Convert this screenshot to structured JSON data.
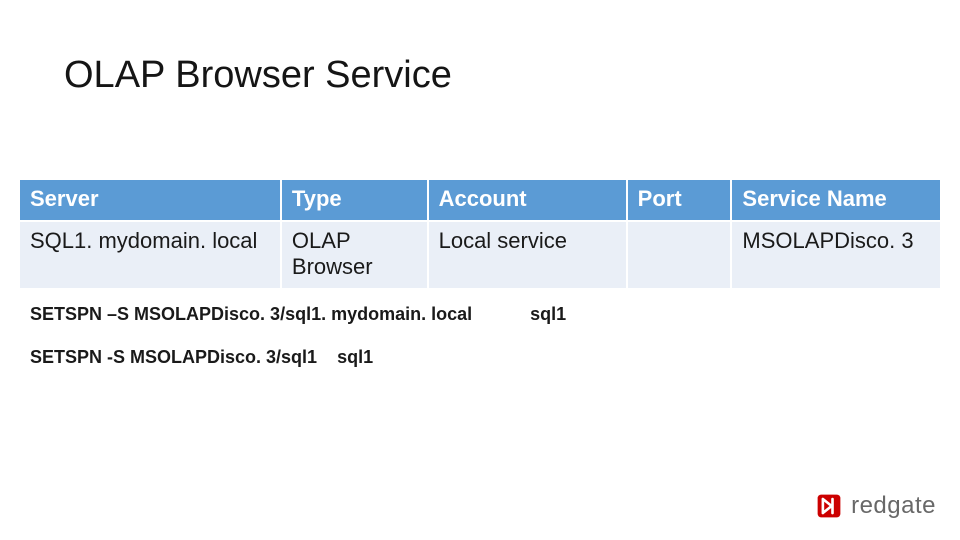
{
  "title": "OLAP Browser Service",
  "table": {
    "headers": [
      "Server",
      "Type",
      "Account",
      "Port",
      "Service Name"
    ],
    "row": {
      "server": "SQL1. mydomain. local",
      "type": "OLAP Browser",
      "account": "Local service",
      "port": "",
      "service_name": "MSOLAPDisco. 3"
    }
  },
  "commands": {
    "line1_a": "SETSPN –S  MSOLAPDisco. 3/sql1. mydomain. local",
    "line1_b": "sql1",
    "line2_a": "SETSPN -S MSOLAPDisco. 3/sql1",
    "line2_b": "sql1"
  },
  "brand": {
    "name": "redgate",
    "color": "#cc0000"
  }
}
